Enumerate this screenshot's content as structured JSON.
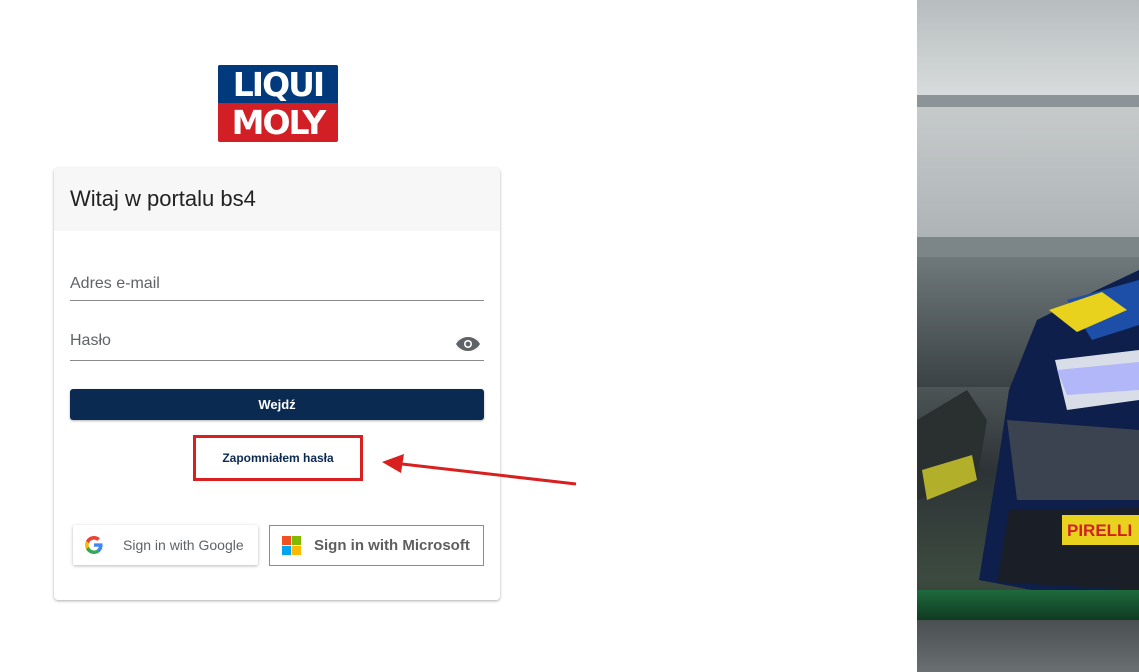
{
  "logo": {
    "line1": "LIQUI",
    "line2": "MOLY",
    "colors": {
      "top": "#003a7d",
      "bottom": "#d21f26"
    }
  },
  "card": {
    "title": "Witaj w portalu bs4"
  },
  "form": {
    "email_label": "Adres e-mail",
    "password_label": "Hasło",
    "submit_label": "Wejdź",
    "forgot_label": "Zapomniałem hasła"
  },
  "sso": {
    "google_label": "Sign in with Google",
    "microsoft_label": "Sign in with Microsoft"
  },
  "photo": {
    "sponsor_text": "PIRELLI"
  },
  "colors": {
    "primary": "#0b2a52",
    "highlight": "#d92020"
  },
  "icons": [
    "eye-icon",
    "google-icon",
    "microsoft-icon",
    "arrow-annotation"
  ]
}
